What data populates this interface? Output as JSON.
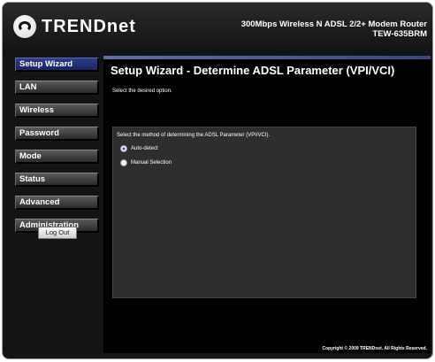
{
  "brand": {
    "logo_text": "TRENDnet"
  },
  "header": {
    "product_line1": "300Mbps Wireless N ADSL 2/2+ Modem Router",
    "product_line2": "TEW-635BRM"
  },
  "sidebar": {
    "items": [
      {
        "label": "Setup Wizard"
      },
      {
        "label": "LAN"
      },
      {
        "label": "Wireless"
      },
      {
        "label": "Password"
      },
      {
        "label": "Mode"
      },
      {
        "label": "Status"
      },
      {
        "label": "Advanced"
      },
      {
        "label": "Administration"
      }
    ],
    "active_index": 0,
    "logout_label": "Log Out"
  },
  "main": {
    "title": "Setup Wizard - Determine ADSL Parameter (VPI/VCI)",
    "instruction": "Select the desired option.",
    "panel_label": "Select the method of determining the ADSL Parameter (VPI/VCI).",
    "options": [
      {
        "label": "Auto-detect",
        "selected": true
      },
      {
        "label": "Manual Selection",
        "selected": false
      }
    ]
  },
  "footer": {
    "copyright": "Copyright © 2009 TRENDnet. All Rights Reserved."
  },
  "colors": {
    "active_nav": "#1f2a72",
    "accent_bar": "#5f6ea8",
    "panel_bg": "#2e2e2e"
  }
}
